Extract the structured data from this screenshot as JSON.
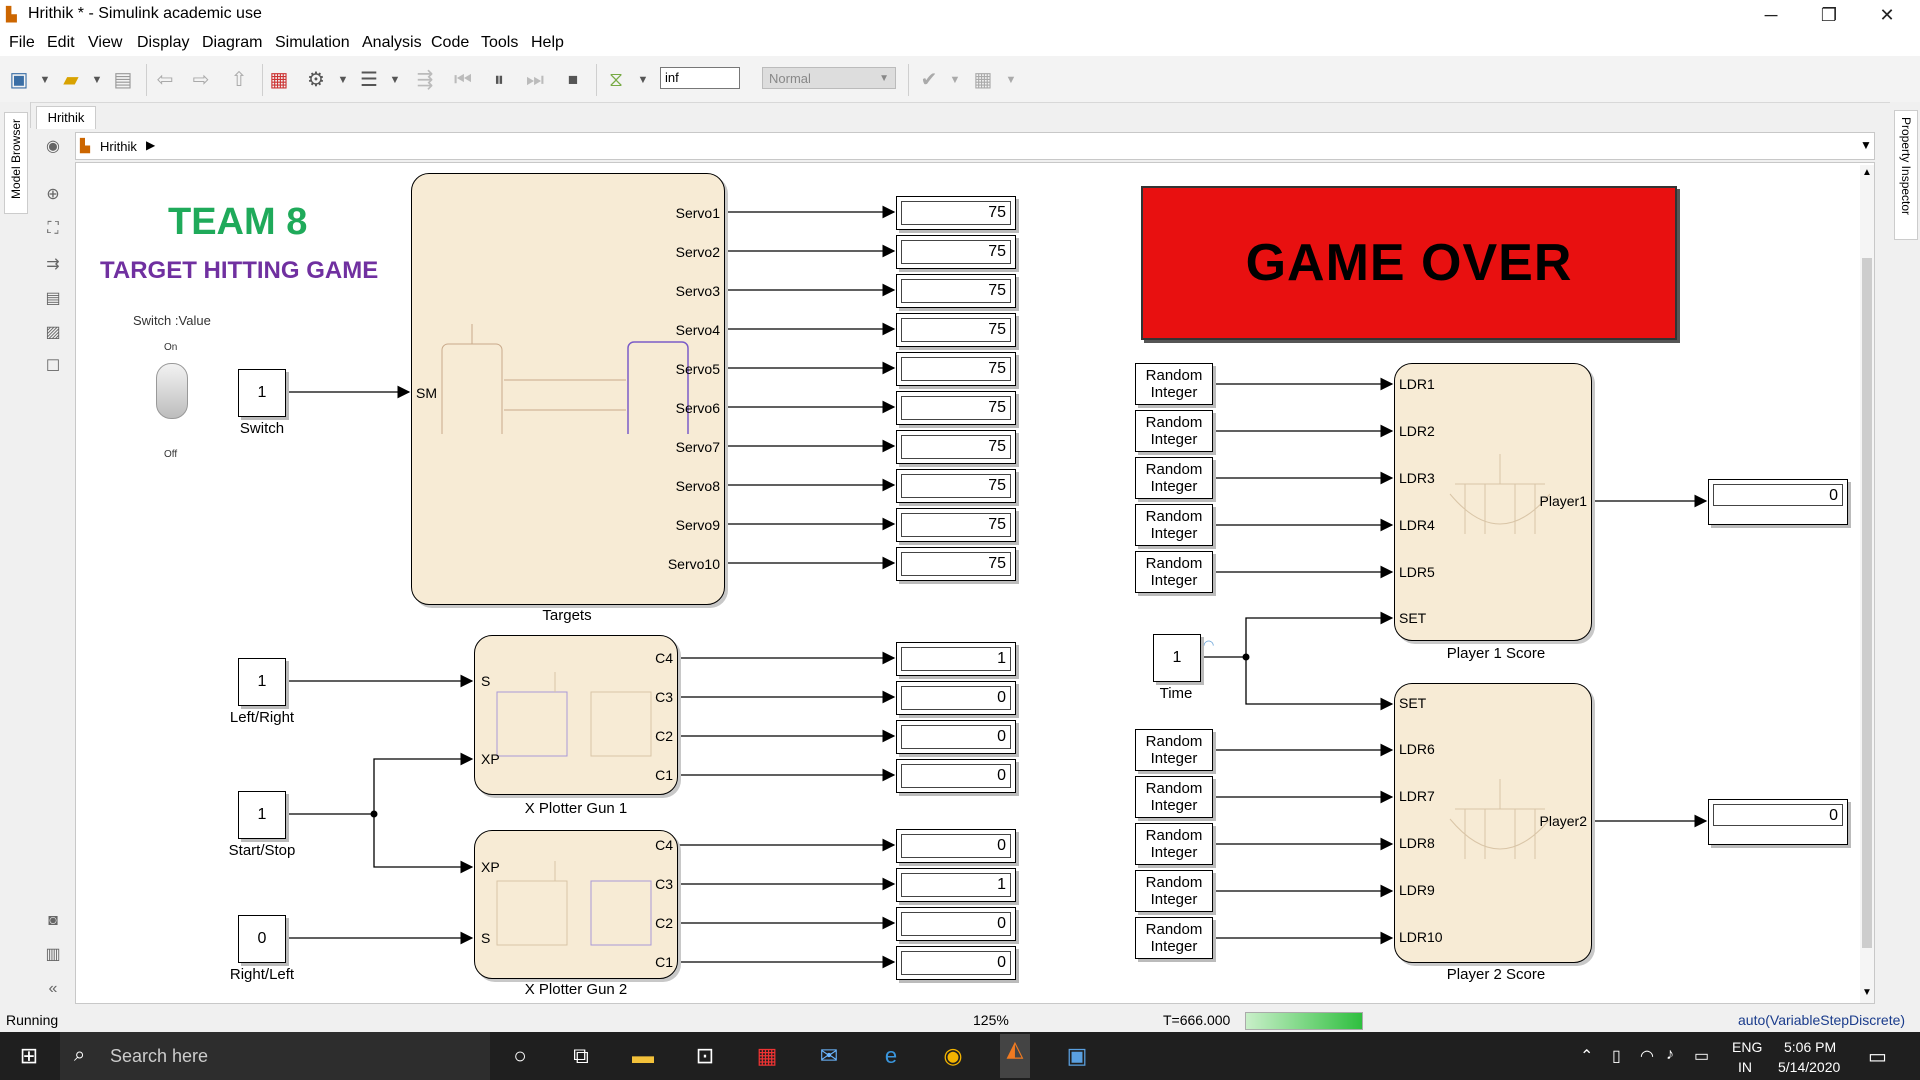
{
  "window": {
    "title": "Hrithik * - Simulink academic use",
    "minimize": "─",
    "restore": "❐",
    "close": "✕"
  },
  "menu": [
    "File",
    "Edit",
    "View",
    "Display",
    "Diagram",
    "Simulation",
    "Analysis",
    "Code",
    "Tools",
    "Help"
  ],
  "toolbar": {
    "stop_time": "inf",
    "sim_mode": "Normal"
  },
  "tabs": {
    "model": "Hrithik"
  },
  "breadcrumb": {
    "model": "Hrithik"
  },
  "side": {
    "left": "Model Browser",
    "right": "Property Inspector"
  },
  "diagram": {
    "heading": "TEAM 8",
    "subheading": "TARGET HITTING GAME",
    "switch": {
      "label": "Switch :Value",
      "on": "On",
      "off": "Off"
    },
    "game_over": "GAME OVER",
    "constants": {
      "switch": {
        "value": "1",
        "label": "Switch"
      },
      "left_right": {
        "value": "1",
        "label": "Left/Right"
      },
      "start_stop": {
        "value": "1",
        "label": "Start/Stop"
      },
      "right_left": {
        "value": "0",
        "label": "Right/Left"
      },
      "time": {
        "value": "1",
        "label": "Time"
      }
    },
    "targets": {
      "label": "Targets",
      "input": "SM",
      "outputs": [
        "Servo1",
        "Servo2",
        "Servo3",
        "Servo4",
        "Servo5",
        "Servo6",
        "Servo7",
        "Servo8",
        "Servo9",
        "Servo10"
      ]
    },
    "target_values": [
      "75",
      "75",
      "75",
      "75",
      "75",
      "75",
      "75",
      "75",
      "75",
      "75"
    ],
    "gun1": {
      "label": "X Plotter Gun 1",
      "inputs": [
        "S",
        "XP"
      ],
      "outputs": [
        "C4",
        "C3",
        "C2",
        "C1"
      ],
      "values": [
        "1",
        "0",
        "0",
        "0"
      ]
    },
    "gun2": {
      "label": "X Plotter Gun 2",
      "inputs": [
        "XP",
        "S"
      ],
      "outputs": [
        "C4",
        "C3",
        "C2",
        "C1"
      ],
      "values": [
        "0",
        "1",
        "0",
        "0"
      ]
    },
    "random": {
      "line1": "Random",
      "line2": "Integer"
    },
    "p1": {
      "label": "Player 1 Score",
      "inputs": [
        "LDR1",
        "LDR2",
        "LDR3",
        "LDR4",
        "LDR5",
        "SET"
      ],
      "output": "Player1",
      "score": "0"
    },
    "p2": {
      "label": "Player 2 Score",
      "inputs": [
        "SET",
        "LDR6",
        "LDR7",
        "LDR8",
        "LDR9",
        "LDR10"
      ],
      "output": "Player2",
      "score": "0"
    }
  },
  "status": {
    "state": "Running",
    "zoom": "125%",
    "time": "T=666.000",
    "solver": "auto(VariableStepDiscrete)",
    "progress": 1.0
  },
  "taskbar": {
    "search": "Search here",
    "lang1": "ENG",
    "lang2": "IN",
    "time": "5:06 PM",
    "date": "5/14/2020"
  }
}
